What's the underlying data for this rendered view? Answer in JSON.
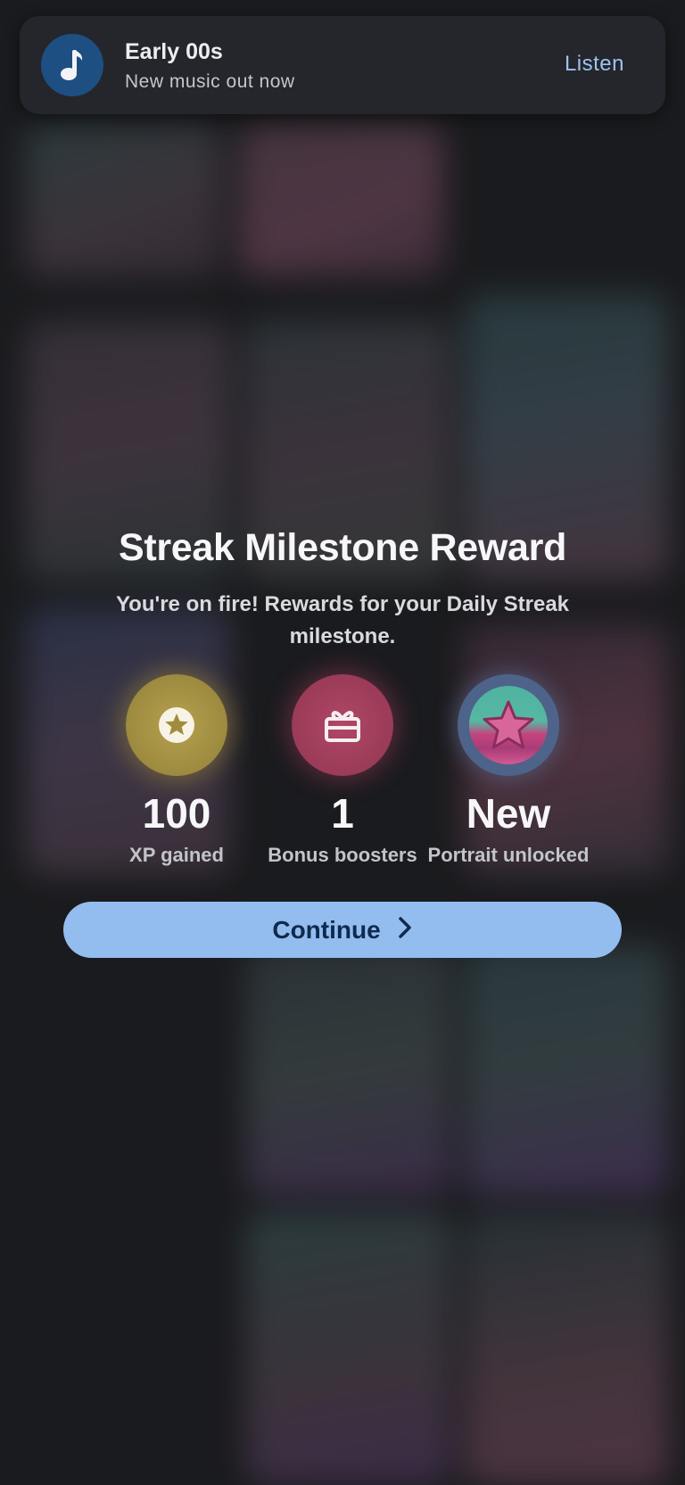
{
  "notification": {
    "title": "Early 00s",
    "subtitle": "New music out now",
    "action_label": "Listen",
    "icon": "music-note-icon"
  },
  "reward_dialog": {
    "title": "Streak Milestone Reward",
    "subtitle": "You're on fire! Rewards for your Daily Streak milestone.",
    "rewards": [
      {
        "value": "100",
        "label": "XP gained",
        "icon": "star-badge-icon",
        "color": "#a8923f"
      },
      {
        "value": "1",
        "label": "Bonus boosters",
        "icon": "gift-icon",
        "color": "#a1405e"
      },
      {
        "value": "New",
        "label": "Portrait unlocked",
        "icon": "portrait-star-icon",
        "color": "#4e6389"
      }
    ],
    "continue_label": "Continue"
  },
  "colors": {
    "accent": "#93bcef",
    "accent_text": "#0f2a4d",
    "notification_link": "#9ec3f0"
  }
}
